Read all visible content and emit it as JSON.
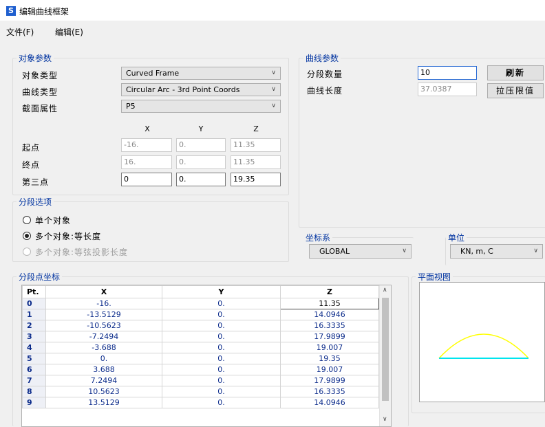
{
  "window": {
    "title": "编辑曲线框架",
    "icon_letter": "S"
  },
  "menu": [
    "文件(F)",
    "编辑(E)"
  ],
  "object_params": {
    "group_label": "对象参数",
    "object_type": {
      "label": "对象类型",
      "value": "Curved Frame"
    },
    "curve_type": {
      "label": "曲线类型",
      "value": "Circular Arc - 3rd Point Coords"
    },
    "section": {
      "label": "截面属性",
      "value": "P5"
    },
    "columns": [
      "X",
      "Y",
      "Z"
    ],
    "rows": [
      {
        "label": "起点",
        "x": "-16.",
        "y": "0.",
        "z": "11.35"
      },
      {
        "label": "终点",
        "x": "16.",
        "y": "0.",
        "z": "11.35"
      },
      {
        "label": "第三点",
        "x": "0",
        "y": "0.",
        "z": "19.35"
      }
    ]
  },
  "curve_params": {
    "group_label": "曲线参数",
    "segments": {
      "label": "分段数量",
      "value": "10"
    },
    "length": {
      "label": "曲线长度",
      "value": "37.0387"
    },
    "refresh_label": "刷新",
    "extrude_label": "拉压限值"
  },
  "seg_options": {
    "group_label": "分段选项",
    "options": [
      "单个对象",
      "多个对象:等长度",
      "多个对象:等弦投影长度"
    ],
    "selected": 1
  },
  "coord_sys": {
    "label": "坐标系",
    "value": "GLOBAL"
  },
  "units": {
    "label": "单位",
    "value": "KN, m, C"
  },
  "table": {
    "group_label": "分段点坐标",
    "headers": [
      "Pt.",
      "X",
      "Y",
      "Z"
    ],
    "rows": [
      [
        "0",
        "-16.",
        "0.",
        "11.35"
      ],
      [
        "1",
        "-13.5129",
        "0.",
        "14.0946"
      ],
      [
        "2",
        "-10.5623",
        "0.",
        "16.3335"
      ],
      [
        "3",
        "-7.2494",
        "0.",
        "17.9899"
      ],
      [
        "4",
        "-3.688",
        "0.",
        "19.007"
      ],
      [
        "5",
        "0.",
        "0.",
        "19.35"
      ],
      [
        "6",
        "3.688",
        "0.",
        "19.007"
      ],
      [
        "7",
        "7.2494",
        "0.",
        "17.9899"
      ],
      [
        "8",
        "10.5623",
        "0.",
        "16.3335"
      ],
      [
        "9",
        "13.5129",
        "0.",
        "14.0946"
      ]
    ]
  },
  "plan_view": {
    "label": "平面视图",
    "arc_color": "#ffff00",
    "chord_color": "#00e5ee"
  }
}
